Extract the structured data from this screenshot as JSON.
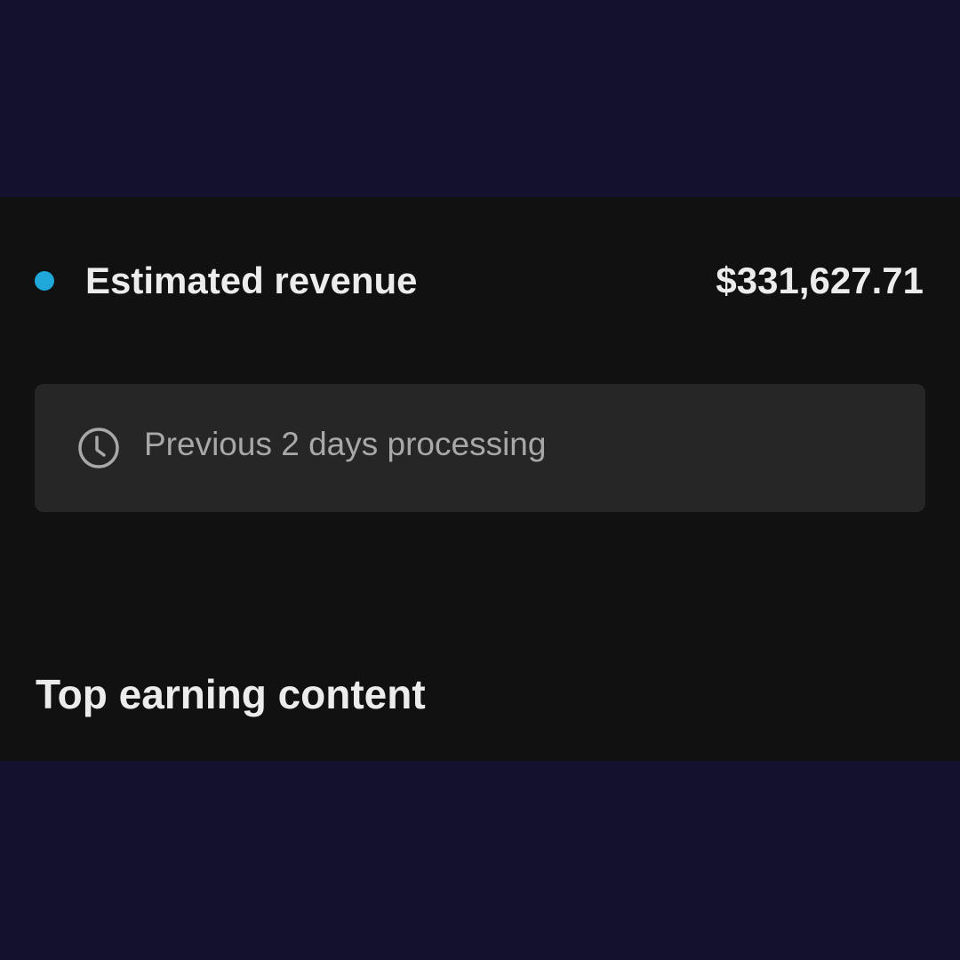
{
  "revenue": {
    "label": "Estimated revenue",
    "value": "$331,627.71",
    "dot_color": "#1ea7d8"
  },
  "notice": {
    "icon": "clock-icon",
    "text": "Previous 2 days processing"
  },
  "section": {
    "title": "Top earning content"
  }
}
